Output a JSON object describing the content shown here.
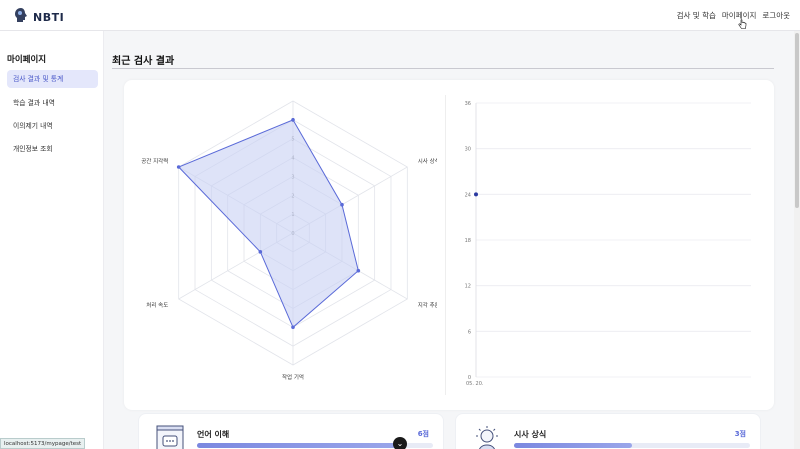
{
  "header": {
    "brand": "NBTI",
    "nav": [
      "검사 및 학습",
      "마이페이지",
      "로그아웃"
    ]
  },
  "sidebar": {
    "title": "마이페이지",
    "items": [
      {
        "label": "검사 결과 및 통계",
        "active": true
      },
      {
        "label": "학습 결과 내역",
        "active": false
      },
      {
        "label": "이의제기 내역",
        "active": false
      },
      {
        "label": "개인정보 조회",
        "active": false
      }
    ]
  },
  "main": {
    "title": "최근 검사 결과"
  },
  "chart_data": [
    {
      "type": "radar",
      "categories": [
        "언어 이해",
        "시사 상식",
        "지각 추론",
        "작업 기억",
        "처리 속도",
        "공간 지각력"
      ],
      "values": [
        6,
        3,
        4,
        5,
        2,
        7
      ],
      "rlim": [
        0,
        7
      ],
      "ticks": [
        "0",
        "1",
        "2",
        "3",
        "4",
        "5",
        "6"
      ],
      "colors": {
        "fill": "#c8d0f4",
        "stroke": "#5a6ad8"
      }
    },
    {
      "type": "line",
      "x": [
        "05. 20."
      ],
      "y": [
        24
      ],
      "ylim": [
        0,
        36
      ],
      "yticks": [
        0,
        6,
        12,
        18,
        24,
        30,
        36
      ],
      "ytick_labels": [
        "0",
        "6",
        "12",
        "18",
        "24",
        "30",
        "36"
      ],
      "grid": true,
      "colors": {
        "point": "#2b3aa0"
      }
    }
  ],
  "score_cards": [
    {
      "title": "언어 이해",
      "score": "6점",
      "progress": 0.857,
      "icon": "chat-book-icon"
    },
    {
      "title": "시사 상식",
      "score": "3점",
      "progress": 0.5,
      "icon": "lightbulb-person-icon"
    }
  ],
  "status_bar": {
    "url": "localhost:5173/mypage/test"
  },
  "colors": {
    "accent": "#5a6ad8",
    "active_bg": "#e4e7fb"
  }
}
